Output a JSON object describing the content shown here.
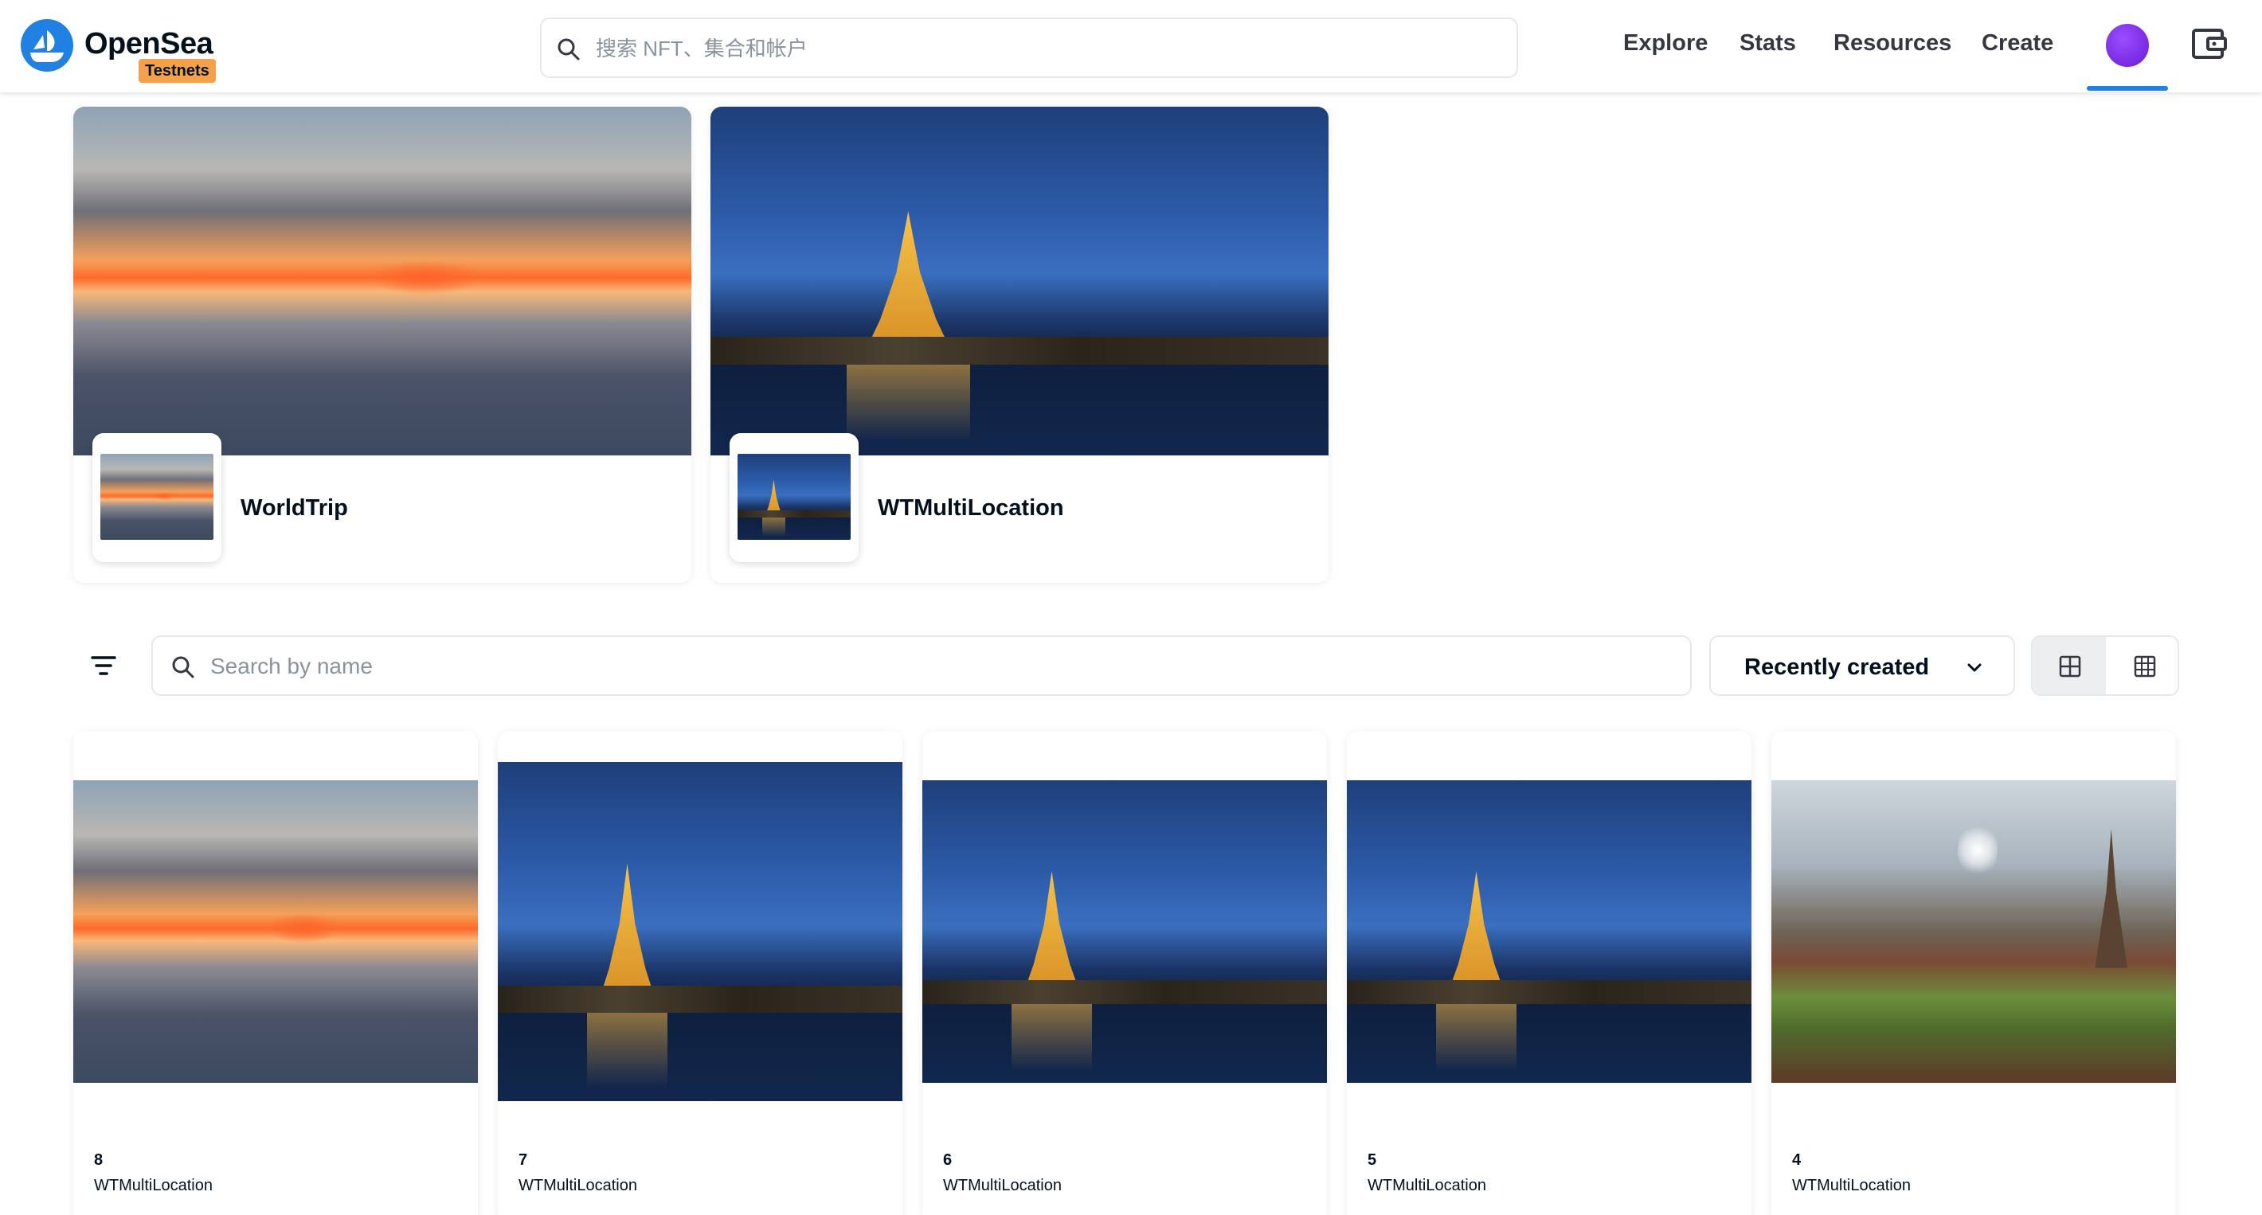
{
  "header": {
    "brand": "OpenSea",
    "badge": "Testnets",
    "search_placeholder": "搜索 NFT、集合和帐户",
    "nav": [
      "Explore",
      "Stats",
      "Resources",
      "Create"
    ],
    "accent_color": "#2081e2"
  },
  "collections": [
    {
      "name": "WorldTrip",
      "image": "sunset-reflection"
    },
    {
      "name": "WTMultiLocation",
      "image": "temple-night"
    }
  ],
  "toolbar": {
    "search_placeholder": "Search by name",
    "sort_label": "Recently created",
    "view_modes": [
      "large-grid",
      "small-grid"
    ]
  },
  "items": [
    {
      "number": "8",
      "collection": "WTMultiLocation",
      "image": "sunset-reflection"
    },
    {
      "number": "7",
      "collection": "WTMultiLocation",
      "image": "temple-night"
    },
    {
      "number": "6",
      "collection": "WTMultiLocation",
      "image": "temple-night"
    },
    {
      "number": "5",
      "collection": "WTMultiLocation",
      "image": "temple-night"
    },
    {
      "number": "4",
      "collection": "WTMultiLocation",
      "image": "ruins-day"
    }
  ]
}
